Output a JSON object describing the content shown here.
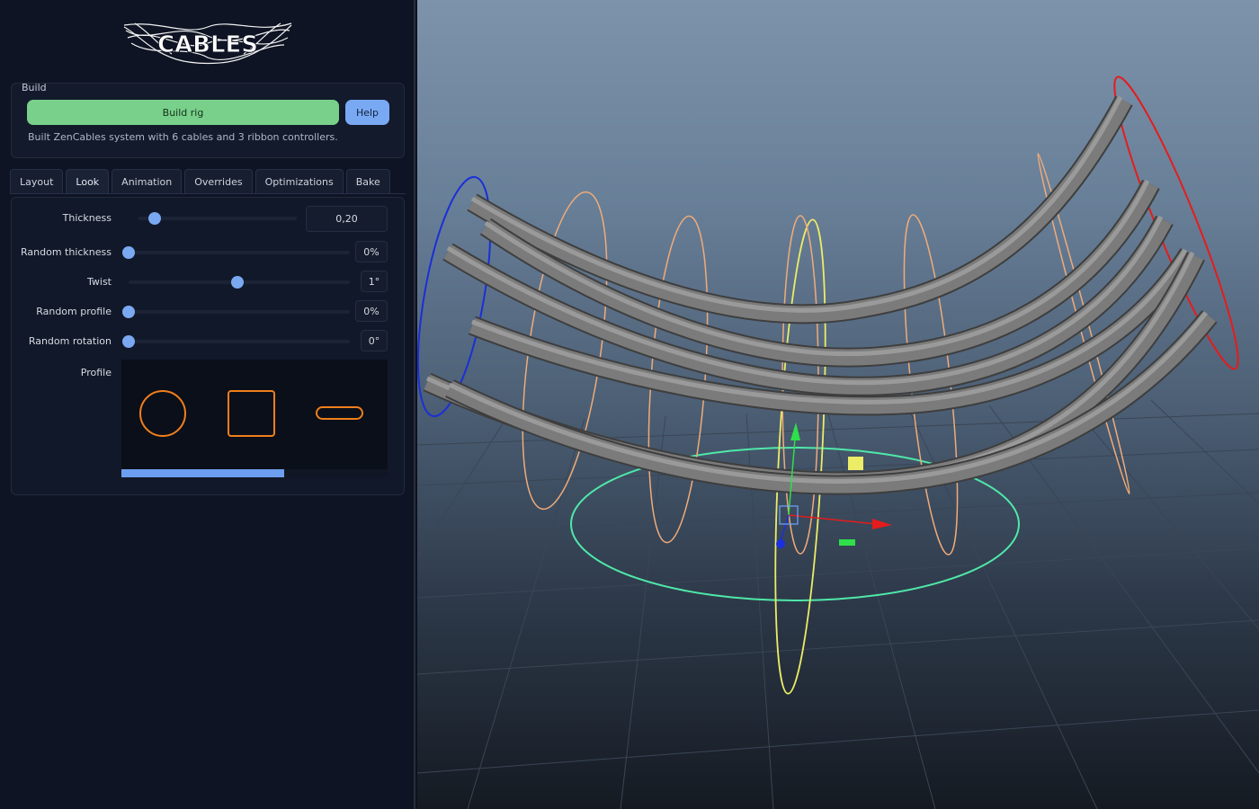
{
  "logo": {
    "text": "CABLES"
  },
  "build": {
    "legend": "Build",
    "build_rig_label": "Build rig",
    "help_label": "Help",
    "status": "Built ZenCables system with 6 cables and 3 ribbon controllers."
  },
  "tabs": [
    {
      "label": "Layout",
      "active": false
    },
    {
      "label": "Look",
      "active": true
    },
    {
      "label": "Animation",
      "active": false
    },
    {
      "label": "Overrides",
      "active": false
    },
    {
      "label": "Optimizations",
      "active": false
    },
    {
      "label": "Bake",
      "active": false
    }
  ],
  "look": {
    "thickness": {
      "label": "Thickness",
      "value": "0,20",
      "fraction": 0.1
    },
    "random_thickness": {
      "label": "Random thickness",
      "value": "0%",
      "fraction": 0.0
    },
    "twist": {
      "label": "Twist",
      "value": "1°",
      "fraction": 0.49
    },
    "random_profile": {
      "label": "Random profile",
      "value": "0%",
      "fraction": 0.0
    },
    "random_rotation": {
      "label": "Random rotation",
      "value": "0°",
      "fraction": 0.0
    },
    "profile": {
      "label": "Profile",
      "options": [
        "circle-profile-icon",
        "square-profile-icon",
        "flat-profile-icon"
      ],
      "scroll_fraction": 0.61
    }
  },
  "colors": {
    "build_button": "#79d08a",
    "accent": "#7aa9f2",
    "profile_shape": "#f07f1c",
    "controller_blue": "#1a2fd8",
    "controller_red": "#e41c1c",
    "controller_orange": "#f0ab78",
    "controller_yellow": "#ecec66",
    "controller_green": "#4fe8a8",
    "cable_gray": "#7b7b7b"
  }
}
